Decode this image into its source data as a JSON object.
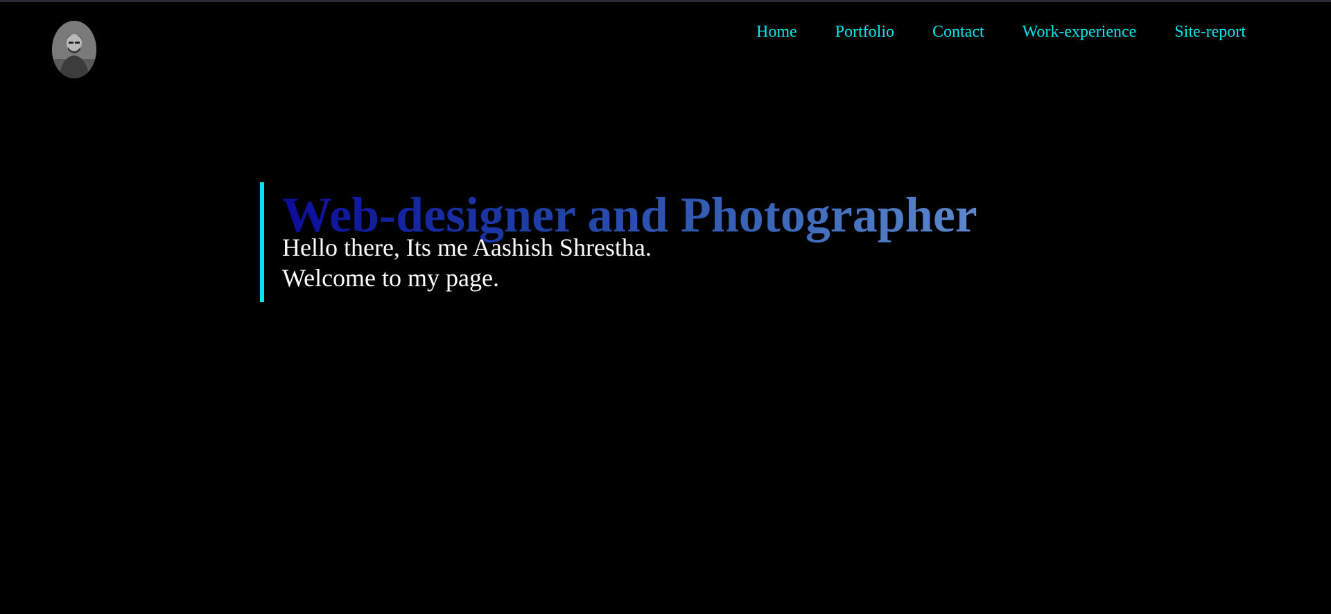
{
  "nav": {
    "items": [
      {
        "label": "Home"
      },
      {
        "label": "Portfolio"
      },
      {
        "label": "Contact"
      },
      {
        "label": "Work-experience"
      },
      {
        "label": "Site-report"
      }
    ]
  },
  "hero": {
    "title": "Web-designer and Photographer",
    "line1": "Hello there, Its me Aashish Shrestha.",
    "line2": "Welcome to my page."
  },
  "colors": {
    "background": "#000000",
    "accent": "#00e5ee",
    "title_gradient_start": "#0c0c9a",
    "title_gradient_end": "#5d88cc",
    "text": "#ffffff"
  }
}
